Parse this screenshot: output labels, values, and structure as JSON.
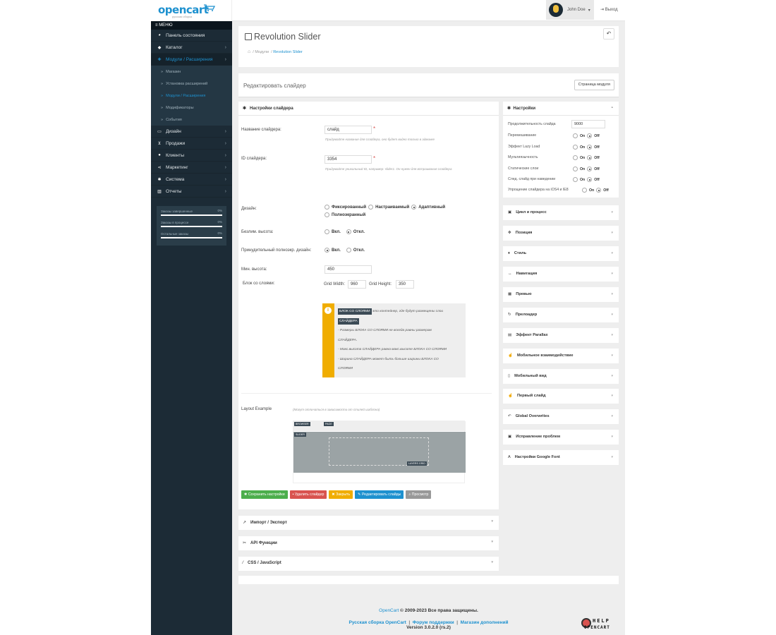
{
  "header": {
    "logo": "opencart",
    "logo_sub": "русская сборка",
    "user_name": "John Doe",
    "logout": "Выход"
  },
  "sidebar": {
    "menu_label": "МЕНЮ",
    "items": [
      {
        "label": "Панель состояния",
        "icon": "dashboard-icon"
      },
      {
        "label": "Каталог",
        "icon": "tag-icon"
      },
      {
        "label": "Модули / Расширения",
        "icon": "puzzle-icon"
      }
    ],
    "sub_items": [
      "Магазин",
      "Установка расширений",
      "Модули / Расширения",
      "Модификаторы",
      "События"
    ],
    "items2": [
      {
        "label": "Дизайн",
        "icon": "monitor-icon"
      },
      {
        "label": "Продажи",
        "icon": "cart-icon"
      },
      {
        "label": "Клиенты",
        "icon": "user-icon"
      },
      {
        "label": "Маркетинг",
        "icon": "share-icon"
      },
      {
        "label": "Система",
        "icon": "cog-icon"
      },
      {
        "label": "Отчеты",
        "icon": "bar-chart-icon"
      }
    ],
    "stats": [
      {
        "label": "Заказы завершенные",
        "pct": "0%"
      },
      {
        "label": "Заказы в процессе",
        "pct": "0%"
      },
      {
        "label": "Остальные заказы",
        "pct": "0%"
      }
    ]
  },
  "page": {
    "title": "Revolution Slider",
    "breadcrumb": [
      "Модули",
      "Revolution Slider"
    ],
    "edit_title": "Редактировать слайдер",
    "module_page_btn": "Страница модуля"
  },
  "form": {
    "head": "Настройки слайдера",
    "name_label": "Название слайдера:",
    "name_value": "слайд",
    "name_help": "Придумайте название для слайдера, оно будет видно только в админке",
    "id_label": "ID слайдера:",
    "id_value": "3354",
    "id_help": "Придумайте уникальный ID, например: slider1. Он нужен для встраивания слайдера",
    "design_label": "Дизайн:",
    "design_opts": [
      "Фиксированный",
      "Настраиваемый",
      "Адаптивный",
      "Полноэкранный"
    ],
    "unlim_label": "Безлим. высота:",
    "force_label": "Принудительный полноэкр. дизайн:",
    "yes": "Вкл.",
    "no": "Откл.",
    "minh_label": "Мин. высота:",
    "minh_value": "450",
    "layers_label": "Блок со слоями:",
    "grid_w_label": "Grid Width:",
    "grid_w": "960",
    "grid_h_label": "Grid Height:",
    "grid_h": "350",
    "info": {
      "tag1": "БЛОК СО СЛОЯМИ",
      "line1": "это контейнер, где будут размещены слои",
      "tag2": "СЛАЙДЕРА",
      "line2": "- Размеры БЛОКА СО СЛОЯМИ не всегда равны размерам",
      "line2b": "СЛАЙДЕРА.",
      "line3": "- Макс.высота СЛАЙДЕРА равна макс.высоте БЛОКА СО СЛОЯМИ",
      "line4": "- Ширина СЛАЙДЕРА может быть больше ширины БЛОКА СО",
      "line4b": "СЛОЯМИ"
    },
    "layout_label": "Layout Example",
    "layout_help": "(Могут отличаться в зависимости от стилей шаблона)",
    "layout_tags": [
      "BROWSER",
      "PAGE",
      "SLIDER",
      "LAYERS GRID"
    ],
    "buttons": [
      "Сохранить настройки",
      "Удалить слайдер",
      "Закрыть",
      "Редактировать слайды",
      "Просмотр"
    ]
  },
  "bottom_sections": [
    "Импорт / Экспорт",
    "API Функции",
    "CSS / JavaScript"
  ],
  "settings": {
    "head": "Настройки",
    "duration_label": "Продолжительность слайда",
    "duration_value": "9000",
    "on": "On",
    "off": "Off",
    "toggles": [
      "Перемешивание",
      "Эффект Lazy Load",
      "Мультиязычность",
      "Статические слои",
      "След. слайд при наведении",
      "Упрощение слайдера на iOS4 и IE8"
    ]
  },
  "right_sections": [
    {
      "label": "Цикл и процесс",
      "icon": "image-icon"
    },
    {
      "label": "Позиция",
      "icon": "move-icon"
    },
    {
      "label": "Стиль",
      "icon": "droplet-icon"
    },
    {
      "label": "Навигация",
      "icon": "arrows-icon"
    },
    {
      "label": "Превью",
      "icon": "grid-icon"
    },
    {
      "label": "Прелоадер",
      "icon": "refresh-icon"
    },
    {
      "label": "Эффект Parallax",
      "icon": "film-icon"
    },
    {
      "label": "Мобильное взаимодействие",
      "icon": "hand-icon"
    },
    {
      "label": "Мобильный вид",
      "icon": "mobile-icon"
    },
    {
      "label": "Первый слайд",
      "icon": "thumbs-up-icon"
    },
    {
      "label": "Global Overwrites",
      "icon": "reply-icon"
    },
    {
      "label": "Исправление проблем",
      "icon": "medkit-icon"
    },
    {
      "label": "Настройки Google Font",
      "icon": "font-icon"
    }
  ],
  "footer": {
    "brand": "OpenCart",
    "copy": "© 2009-2023 Все права защищены.",
    "links": [
      "Русская сборка OpenCart",
      "Форум поддержки",
      "Магазин дополнений"
    ],
    "version": "Version 3.0.2.0 (rs.2)",
    "help_logo_1": "HELP",
    "help_logo_2": "OPENCART"
  }
}
